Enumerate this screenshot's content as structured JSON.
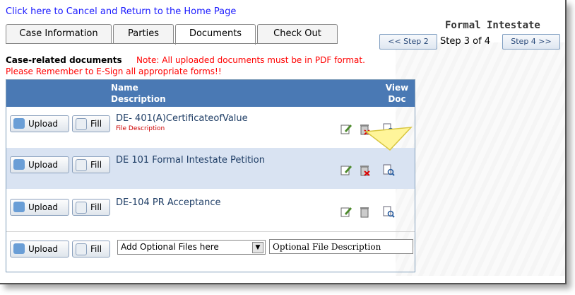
{
  "cancel_link": "Click here to Cancel and Return to the Home Page",
  "tabs": [
    {
      "label": "Case Information"
    },
    {
      "label": "Parties"
    },
    {
      "label": "Documents",
      "active": true
    },
    {
      "label": "Check Out"
    }
  ],
  "wizard": {
    "title": "Formal Intestate",
    "prev": "<< Step 2",
    "current": "Step 3 of 4",
    "next": "Step 4 >>"
  },
  "section_label": "Case-related documents",
  "note": "Note: All uploaded documents must be in PDF format.",
  "note2": "Please Remember to E-Sign all appropriate forms!!",
  "table": {
    "header_name": "Name",
    "header_desc": "Description",
    "header_view": "View",
    "header_doc": "Doc",
    "upload_label": "Upload",
    "fill_label": "Fill",
    "rows": [
      {
        "name": "DE- 401(A)CertificateofValue",
        "desc": "File Description"
      },
      {
        "name": "DE 101 Formal Intestate Petition"
      },
      {
        "name": "DE-104 PR Acceptance"
      }
    ],
    "optional_select": "Add Optional Files here",
    "optional_input": "Optional File Description"
  },
  "colors": {
    "header": "#4a79b4",
    "alt_row": "#d9e3f2",
    "link": "#1a1aff",
    "note": "#ff0000"
  }
}
